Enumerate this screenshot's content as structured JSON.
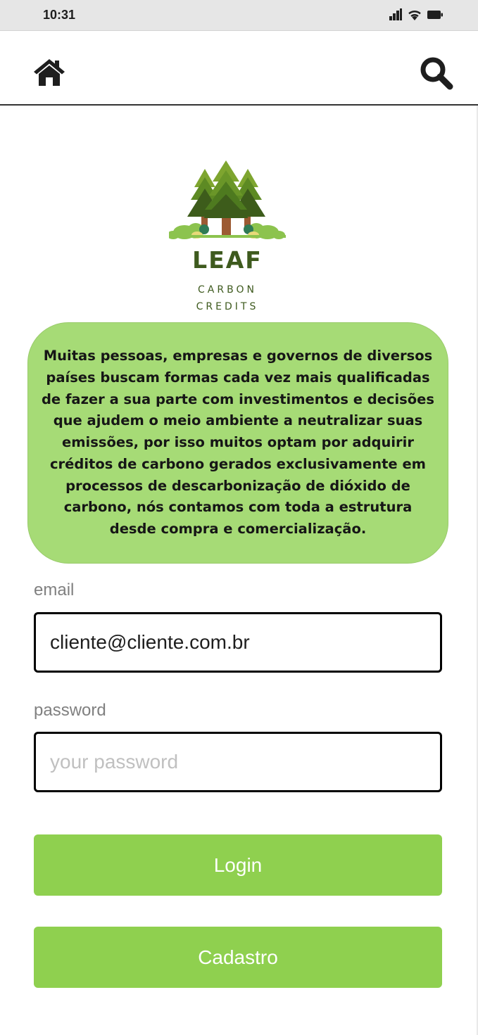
{
  "status_bar": {
    "time": "10:31",
    "icons": [
      "signal-icon",
      "wifi-icon",
      "battery-icon"
    ]
  },
  "nav": {
    "home_icon": "home-icon",
    "search_icon": "search-icon"
  },
  "logo": {
    "title": "LEAF",
    "subtitle_line1": "CARBON",
    "subtitle_line2": "CREDITS"
  },
  "info": {
    "text": "Muitas pessoas, empresas e governos de diversos países buscam formas cada vez mais qualificadas de fazer a sua parte com investimentos e decisões que ajudem o meio ambiente a neutralizar suas emissões, por isso muitos optam por adquirir créditos de carbono gerados exclusivamente em processos de descarbonização de dióxido de carbono, nós contamos com toda a estrutura desde compra e comercialização."
  },
  "form": {
    "email_label": "email",
    "email_value": "cliente@cliente.com.br",
    "password_label": "password",
    "password_placeholder": "your password",
    "login_label": "Login",
    "register_label": "Cadastro"
  },
  "colors": {
    "accent_green": "#8fd04f",
    "card_green": "#a6db76",
    "logo_dark_green": "#3e5a1e"
  }
}
